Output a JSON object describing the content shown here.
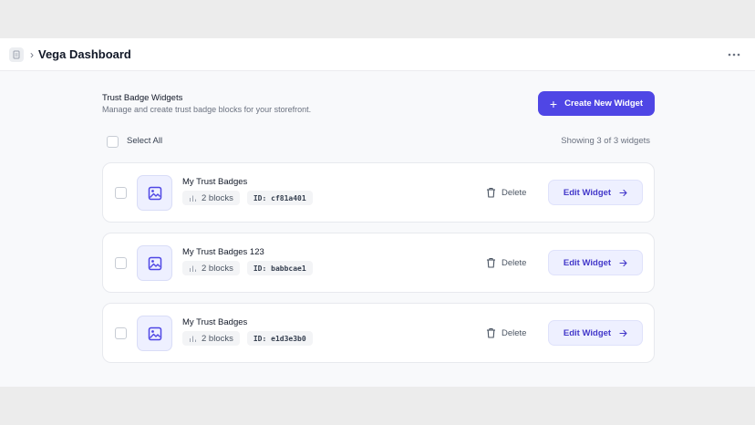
{
  "window": {
    "title": "Vega Dashboard",
    "breadcrumb_separator": "›"
  },
  "header": {
    "title": "Trust Badge Widgets",
    "subtitle": "Manage and create trust badge blocks for your storefront.",
    "create_button": {
      "label": "Create New Widget",
      "icon": "+"
    }
  },
  "selection": {
    "select_all_label": "Select All",
    "count_text": "Showing 3 of 3 widgets"
  },
  "widgets": [
    {
      "name": "My Trust Badges",
      "blocks": "2 blocks",
      "id": "ID: cf81a401",
      "delete_label": "Delete",
      "edit_label": "Edit Widget"
    },
    {
      "name": "My Trust Badges 123",
      "blocks": "2 blocks",
      "id": "ID: babbcae1",
      "delete_label": "Delete",
      "edit_label": "Edit Widget"
    },
    {
      "name": "My Trust Badges",
      "blocks": "2 blocks",
      "id": "ID: e1d3e3b0",
      "delete_label": "Delete",
      "edit_label": "Edit Widget"
    }
  ],
  "colors": {
    "accent": "#4f46e5",
    "accent_soft": "#eef0ff",
    "page_bg": "#f8f9fb"
  },
  "icons": [
    "document-icon",
    "more-horizontal-icon",
    "plus-icon",
    "image-icon",
    "bar-chart-icon",
    "trash-icon",
    "arrow-right-icon"
  ]
}
